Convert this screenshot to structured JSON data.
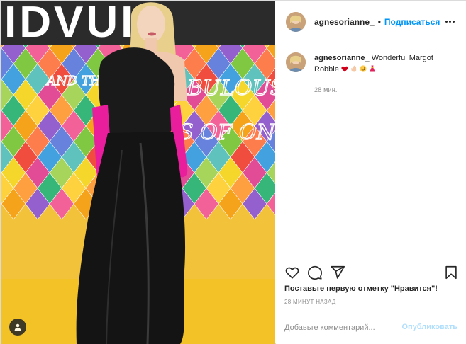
{
  "photo": {
    "alt_icon": "person-tag-icon",
    "backdrop_text_lines": [
      "AND THE",
      "ABULOUS",
      "S OF ON"
    ],
    "backdrop_title": "IDVUI"
  },
  "header": {
    "username": "agnesorianne_",
    "separator": "•",
    "follow_label": "Подписаться",
    "more_icon": "more-options-icon"
  },
  "caption": {
    "username": "agnesorianne_",
    "text": "Wonderful Margot Robbie",
    "time": "28 мин."
  },
  "actions": {
    "like_icon": "heart-icon",
    "comment_icon": "comment-icon",
    "share_icon": "share-icon",
    "save_icon": "bookmark-icon"
  },
  "likes_text": "Поставьте первую отметку \"Нравится\"!",
  "timestamp": "28 МИНУТ НАЗАД",
  "add_comment": {
    "placeholder": "Добавьте комментарий...",
    "publish_label": "Опубликовать"
  },
  "colors": {
    "accent": "#0095f6",
    "publish_disabled": "#b2dffc",
    "muted": "#8e8e8e"
  }
}
